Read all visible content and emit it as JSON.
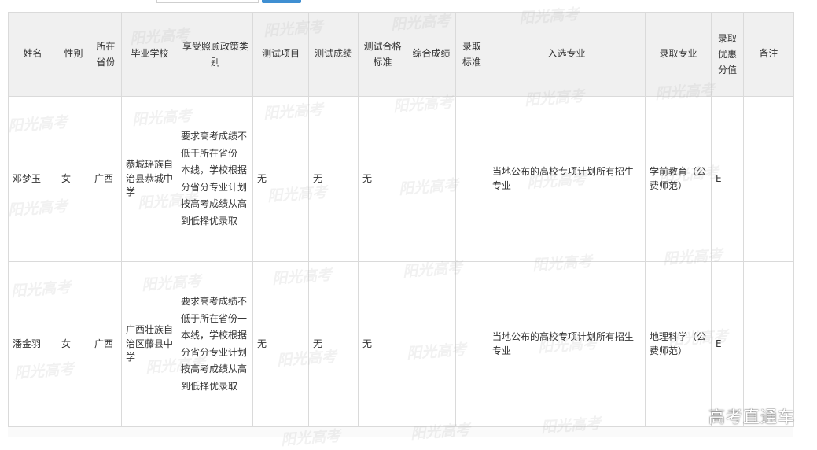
{
  "search": {
    "input_value": ""
  },
  "table": {
    "headers": [
      "姓名",
      "性别",
      "所在省份",
      "毕业学校",
      "享受照顾政策类别",
      "测试项目",
      "测试成绩",
      "测试合格标准",
      "综合成绩",
      "录取标准",
      "入选专业",
      "录取专业",
      "录取优惠分值",
      "备注"
    ],
    "rows": [
      {
        "name": "邓梦玉",
        "gender": "女",
        "province": "广西",
        "school": "恭城瑶族自治县恭城中学",
        "policy": "要求高考成绩不低于所在省份一本线，学校根据分省分专业计划按高考成绩从高到低择优录取",
        "test_item": "无",
        "test_score": "无",
        "test_standard": "无",
        "overall_score": "",
        "admission_standard": "",
        "selected_major": "当地公布的高校专项计划所有招生专业",
        "admitted_major": "学前教育（公费师范）",
        "bonus": "E",
        "remark": ""
      },
      {
        "name": "潘金羽",
        "gender": "女",
        "province": "广西",
        "school": "广西壮族自治区藤县中学",
        "policy": "要求高考成绩不低于所在省份一本线，学校根据分省分专业计划按高考成绩从高到低择优录取",
        "test_item": "无",
        "test_score": "无",
        "test_standard": "无",
        "overall_score": "",
        "admission_standard": "",
        "selected_major": "当地公布的高校专项计划所有招生专业",
        "admitted_major": "地理科学（公费师范）",
        "bonus": "E",
        "remark": ""
      }
    ]
  },
  "watermarks": {
    "repeated_text": "阳光高考",
    "corner_text": "高考直通车"
  },
  "colors": {
    "header_bg": "#f0f0f0",
    "border": "#dadada",
    "button": "#3f8fd2"
  }
}
